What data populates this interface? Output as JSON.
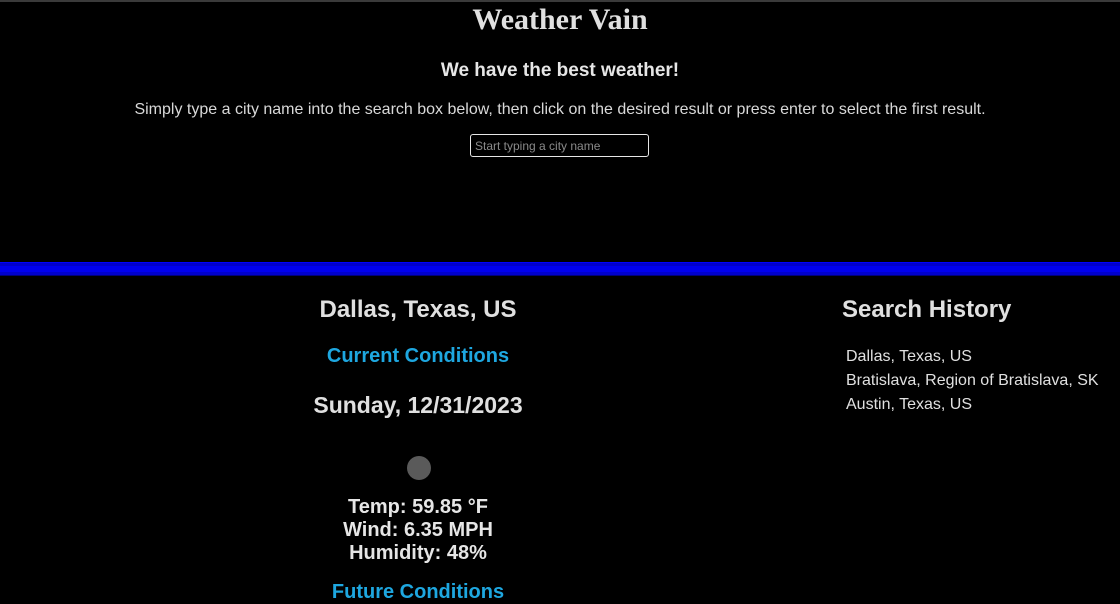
{
  "header": {
    "title": "Weather Vain",
    "tagline": "We have the best weather!",
    "instructions": "Simply type a city name into the search box below, then click on the desired result or press enter to select the first result."
  },
  "search": {
    "placeholder": "Start typing a city name",
    "value": ""
  },
  "weather": {
    "city": "Dallas, Texas, US",
    "current_heading": "Current Conditions",
    "date": "Sunday, 12/31/2023",
    "icon": "weather-icon",
    "temp": "Temp: 59.85 °F",
    "wind": "Wind: 6.35 MPH",
    "humidity": "Humidity: 48%",
    "future_heading": "Future Conditions"
  },
  "history": {
    "title": "Search History",
    "items": [
      {
        "label": "Dallas, Texas, US"
      },
      {
        "label": "Bratislava, Region of Bratislava, SK"
      },
      {
        "label": "Austin, Texas, US"
      }
    ]
  },
  "colors": {
    "background": "#000000",
    "accent_heading": "#1ea7e0",
    "divider": "#0000ee",
    "text": "#e0e0e0"
  }
}
